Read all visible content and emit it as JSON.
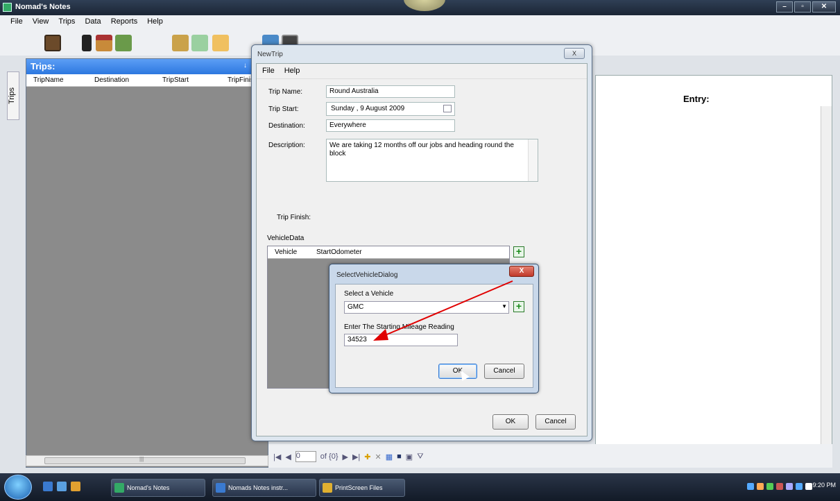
{
  "window": {
    "title": "Nomad's Notes"
  },
  "menubar": [
    "File",
    "View",
    "Trips",
    "Data",
    "Reports",
    "Help"
  ],
  "toolbar_icons": [
    "briefcase-icon",
    "phone-icon",
    "home-icon",
    "campground-icon",
    "vehicle-icon",
    "map-icon",
    "beach-icon",
    "transfer-icon",
    "dvd-icon"
  ],
  "side_tab": "Trips",
  "trips_panel": {
    "title": "Trips:",
    "pin": "↓",
    "columns": [
      "TripName",
      "Destination",
      "TripStart",
      "TripFinish"
    ],
    "scroll_grip": "|||"
  },
  "entry_panel": {
    "label": "Entry:"
  },
  "nav_bar": {
    "first": "|◀",
    "prev": "◀",
    "position": "0",
    "of": "of {0}",
    "next": "▶",
    "last": "▶|"
  },
  "new_trip": {
    "title": "NewTrip",
    "close": "X",
    "menu": [
      "File",
      "Help"
    ],
    "trip_name_label": "Trip Name:",
    "trip_name_value": "Round Australia",
    "trip_start_label": "Trip Start:",
    "trip_start_value": "Sunday   ,  9   August   2009",
    "destination_label": "Destination:",
    "destination_value": "Everywhere",
    "description_label": "Description:",
    "description_value": "We are taking 12 months off our jobs and heading round the block",
    "trip_finish_label": "Trip Finish:",
    "vehicle_data_label": "VehicleData",
    "vehicle_columns": [
      "Vehicle",
      "StartOdometer"
    ],
    "add_vehicle": "+",
    "ok": "OK",
    "cancel": "Cancel"
  },
  "select_vehicle": {
    "title": "SelectVehicleDialog",
    "close": "X",
    "select_label": "Select a Vehicle",
    "selected_vehicle": "GMC",
    "add": "+",
    "mileage_label": "Enter The Starting Mileage Reading",
    "mileage_value": "34523",
    "ok": "OK",
    "cancel": "Cancel"
  },
  "taskbar": {
    "items": [
      "Nomad's Notes",
      "Nomads Notes instr...",
      "PrintScreen Files"
    ],
    "clock": "9:20 PM"
  },
  "colors": {
    "accent": "#2d78e0",
    "annotation_arrow": "#e00000",
    "add_green": "#1a8a1a"
  }
}
